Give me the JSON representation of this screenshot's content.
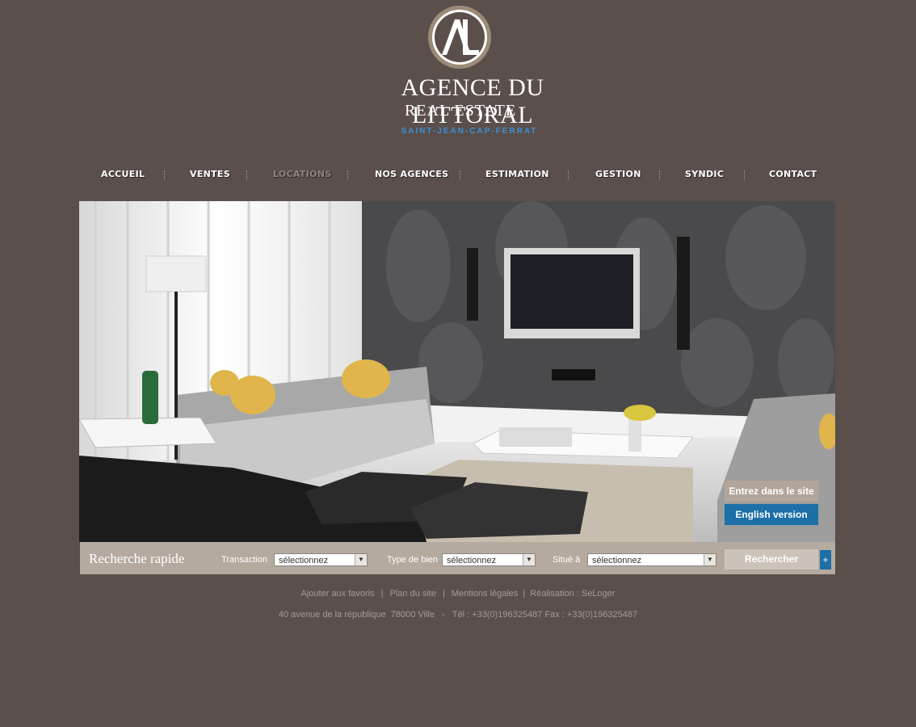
{
  "brand": {
    "monogram": "AL",
    "line1": "AGENCE DU LITTORAL",
    "line2": "REAL ESTATE",
    "line3": "SAINT-JEAN-CAP-FERRAT"
  },
  "nav": {
    "items": [
      {
        "label": "ACCUEIL"
      },
      {
        "label": "VENTES"
      },
      {
        "label": "LOCATIONS"
      },
      {
        "label": "NOS AGENCES"
      },
      {
        "label": "ESTIMATION"
      },
      {
        "label": "GESTION"
      },
      {
        "label": "SYNDIC"
      },
      {
        "label": "CONTACT"
      }
    ],
    "active": "LOCATIONS"
  },
  "hero": {
    "enter_label": "Entrez dans le site",
    "english_label": "English version"
  },
  "search": {
    "title": "Recherche rapide",
    "transaction_label": "Transaction",
    "transaction_value": "sélectionnez",
    "type_label": "Type de bien",
    "type_value": "sélectionnez",
    "location_label": "Situé à",
    "location_value": "sélectionnez",
    "submit_label": "Rechercher",
    "plus_label": "+"
  },
  "footer": {
    "favorites": "Ajouter aux favoris",
    "sitemap": "Plan du site",
    "legal": "Mentions légales",
    "credits": "Réalisation : SeLoger",
    "address": "40 avenue de la république  78000 Ville   -   Tél : +33(0)196325487 Fax : +33(0)196325487"
  },
  "colors": {
    "background": "#5a4f4b",
    "accent_blue": "#1c6fa7",
    "taupe": "#b4aa9f"
  }
}
